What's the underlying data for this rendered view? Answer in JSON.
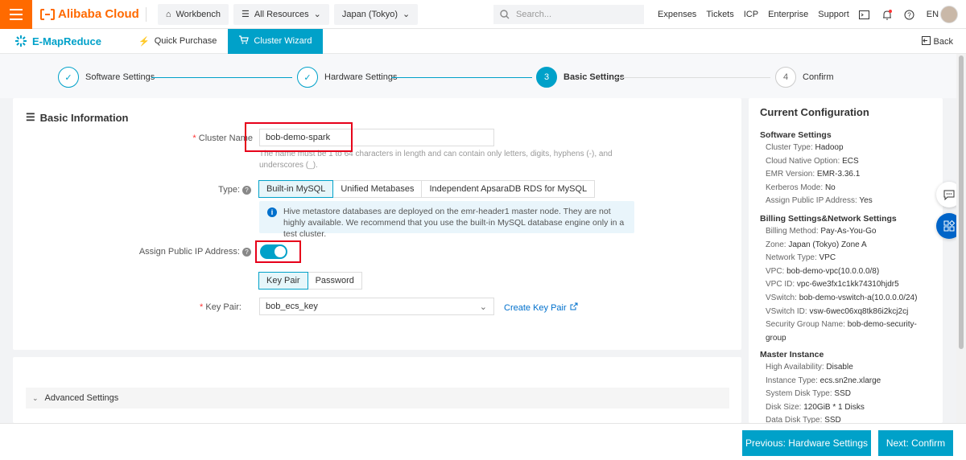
{
  "topbar": {
    "brand": "Alibaba Cloud",
    "workbench": "Workbench",
    "all_resources": "All Resources",
    "region": "Japan (Tokyo)",
    "search_placeholder": "Search...",
    "links": [
      "Expenses",
      "Tickets",
      "ICP",
      "Enterprise",
      "Support"
    ],
    "lang": "EN"
  },
  "subbar": {
    "product": "E-MapReduce",
    "quick_purchase": "Quick Purchase",
    "cluster_wizard": "Cluster Wizard",
    "back": "Back"
  },
  "steps": [
    {
      "label": "Software Settings",
      "state": "done"
    },
    {
      "label": "Hardware Settings",
      "state": "done"
    },
    {
      "label": "Basic Settings",
      "number": "3",
      "state": "current"
    },
    {
      "label": "Confirm",
      "number": "4",
      "state": "todo"
    }
  ],
  "form": {
    "section_title": "Basic Information",
    "cluster_name_label": "Cluster Name",
    "cluster_name_value": "bob-demo-spark",
    "cluster_name_hint": "The name must be 1 to 64 characters in length and can contain only letters, digits, hyphens (-), and underscores (_).",
    "type_label": "Type:",
    "type_options": [
      "Built-in MySQL",
      "Unified Metabases",
      "Independent ApsaraDB RDS for MySQL"
    ],
    "type_selected": "Built-in MySQL",
    "type_info": "Hive metastore databases are deployed on the emr-header1 master node. They are not highly available. We recommend that you use the built-in MySQL database engine only in a test cluster.",
    "public_ip_label": "Assign Public IP Address:",
    "public_ip_on": true,
    "auth_options": [
      "Key Pair",
      "Password"
    ],
    "auth_selected": "Key Pair",
    "key_pair_label": "Key Pair:",
    "key_pair_value": "bob_ecs_key",
    "create_key_pair": "Create Key Pair",
    "advanced_settings": "Advanced Settings"
  },
  "config": {
    "title": "Current Configuration",
    "software_title": "Software Settings",
    "software": [
      {
        "k": "Cluster Type:",
        "v": "Hadoop"
      },
      {
        "k": "Cloud Native Option:",
        "v": "ECS"
      },
      {
        "k": "EMR Version:",
        "v": "EMR-3.36.1"
      },
      {
        "k": "Kerberos Mode:",
        "v": "No"
      },
      {
        "k": "Assign Public IP Address:",
        "v": "Yes"
      }
    ],
    "billing_title": "Billing Settings&Network Settings",
    "billing": [
      {
        "k": "Billing Method:",
        "v": "Pay-As-You-Go"
      },
      {
        "k": "Zone:",
        "v": "Japan (Tokyo) Zone A"
      },
      {
        "k": "Network Type:",
        "v": "VPC"
      },
      {
        "k": "VPC:",
        "v": "bob-demo-vpc(10.0.0.0/8)"
      },
      {
        "k": "VPC ID:",
        "v": "vpc-6we3fx1c1kk74310hjdr5"
      },
      {
        "k": "VSwitch:",
        "v": "bob-demo-vswitch-a(10.0.0.0/24)"
      },
      {
        "k": "VSwitch ID:",
        "v": "vsw-6wec06xq8tk86i2kcj2cj"
      },
      {
        "k": "Security Group Name:",
        "v": "bob-demo-security-"
      },
      {
        "k": "",
        "v": "group"
      }
    ],
    "master_title": "Master Instance",
    "master": [
      {
        "k": "High Availability:",
        "v": "Disable"
      },
      {
        "k": "Instance Type:",
        "v": "ecs.sn2ne.xlarge"
      },
      {
        "k": "System Disk Type:",
        "v": "SSD"
      },
      {
        "k": "Disk Size:",
        "v": "120GiB * 1 Disks"
      },
      {
        "k": "Data Disk Type:",
        "v": "SSD"
      }
    ]
  },
  "footer": {
    "prev": "Previous: Hardware Settings",
    "next": "Next: Confirm"
  },
  "colors": {
    "accent": "#00a1c9",
    "brand": "#ff6a00",
    "highlight": "#e6001a"
  }
}
